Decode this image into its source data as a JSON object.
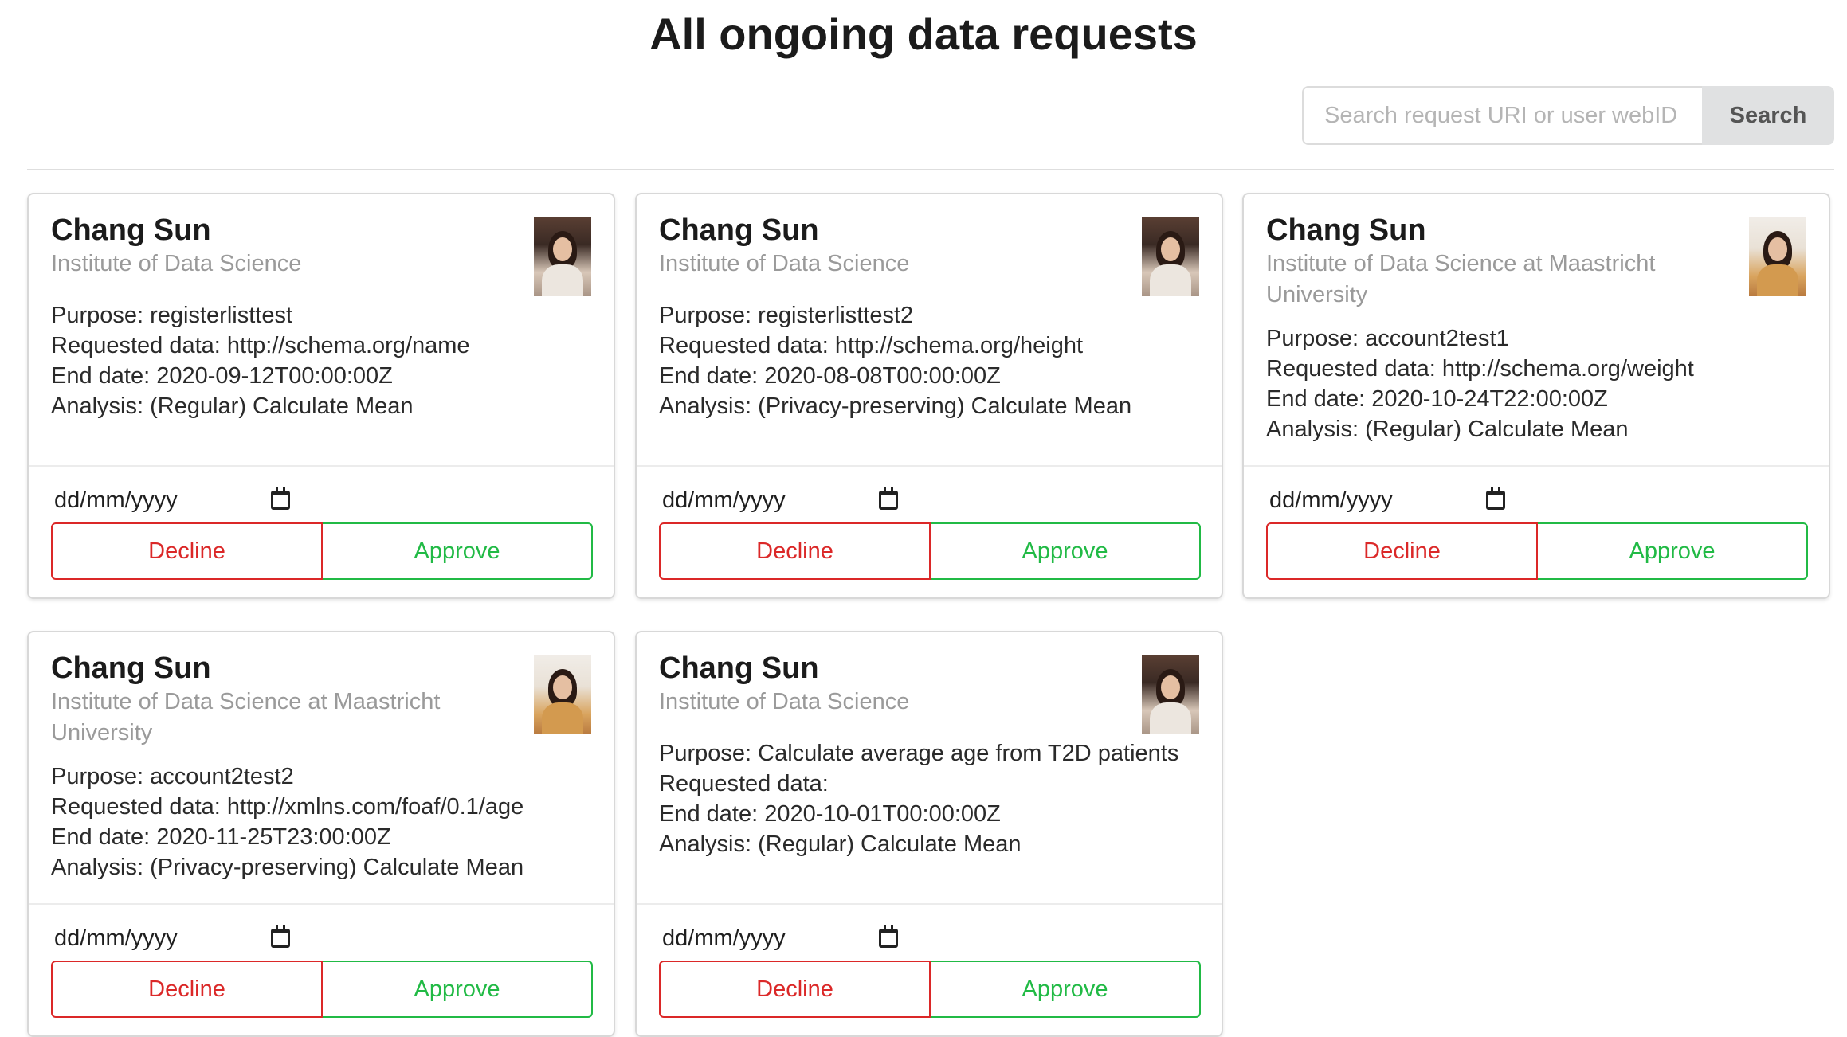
{
  "header": {
    "title": "All ongoing data requests"
  },
  "search": {
    "placeholder": "Search request URI or user webID",
    "button_label": "Search"
  },
  "cards": [
    {
      "name": "Chang Sun",
      "organization": "Institute of Data Science",
      "purpose": "Purpose: registerlisttest",
      "requested_data": "Requested data: http://schema.org/name",
      "end_date": "End date: 2020-09-12T00:00:00Z",
      "analysis": "Analysis: (Regular) Calculate Mean",
      "date_placeholder": "dd/mm/yyyy",
      "decline_label": "Decline",
      "approve_label": "Approve"
    },
    {
      "name": "Chang Sun",
      "organization": "Institute of Data Science",
      "purpose": "Purpose: registerlisttest2",
      "requested_data": "Requested data: http://schema.org/height",
      "end_date": "End date: 2020-08-08T00:00:00Z",
      "analysis": "Analysis: (Privacy-preserving) Calculate Mean",
      "date_placeholder": "dd/mm/yyyy",
      "decline_label": "Decline",
      "approve_label": "Approve"
    },
    {
      "name": "Chang Sun",
      "organization": "Institute of Data Science at Maastricht University",
      "purpose": "Purpose: account2test1",
      "requested_data": "Requested data: http://schema.org/weight",
      "end_date": "End date: 2020-10-24T22:00:00Z",
      "analysis": "Analysis: (Regular) Calculate Mean",
      "date_placeholder": "dd/mm/yyyy",
      "decline_label": "Decline",
      "approve_label": "Approve"
    },
    {
      "name": "Chang Sun",
      "organization": "Institute of Data Science at Maastricht University",
      "purpose": "Purpose: account2test2",
      "requested_data": "Requested data: http://xmlns.com/foaf/0.1/age",
      "end_date": "End date: 2020-11-25T23:00:00Z",
      "analysis": "Analysis: (Privacy-preserving) Calculate Mean",
      "date_placeholder": "dd/mm/yyyy",
      "decline_label": "Decline",
      "approve_label": "Approve"
    },
    {
      "name": "Chang Sun",
      "organization": "Institute of Data Science",
      "purpose": "Purpose: Calculate average age from T2D patients",
      "requested_data": "Requested data:",
      "end_date": "End date: 2020-10-01T00:00:00Z",
      "analysis": "Analysis: (Regular) Calculate Mean",
      "date_placeholder": "dd/mm/yyyy",
      "decline_label": "Decline",
      "approve_label": "Approve"
    }
  ]
}
